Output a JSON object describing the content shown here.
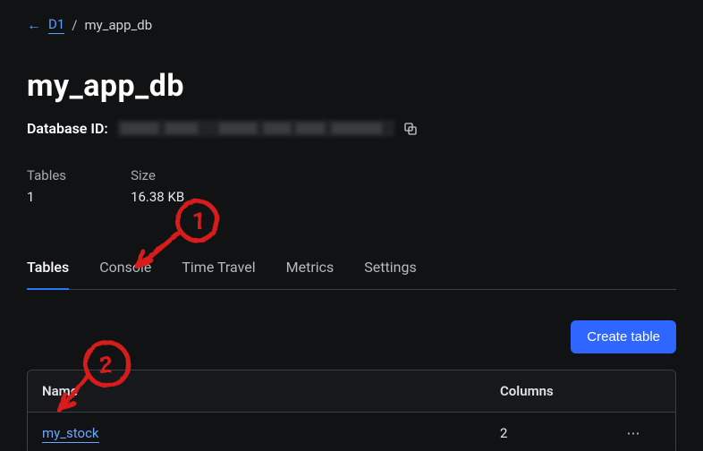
{
  "breadcrumb": {
    "back_link": "D1",
    "current": "my_app_db"
  },
  "title": "my_app_db",
  "database_id_label": "Database ID:",
  "stats": {
    "tables_label": "Tables",
    "tables_value": "1",
    "size_label": "Size",
    "size_value": "16.38 KB"
  },
  "tabs": {
    "tables": "Tables",
    "console": "Console",
    "time_travel": "Time Travel",
    "metrics": "Metrics",
    "settings": "Settings"
  },
  "create_button": "Create table",
  "table_headers": {
    "name": "Name",
    "columns": "Columns"
  },
  "rows": [
    {
      "name": "my_stock",
      "columns": "2"
    }
  ],
  "annotations": {
    "one": "1",
    "two": "2"
  }
}
